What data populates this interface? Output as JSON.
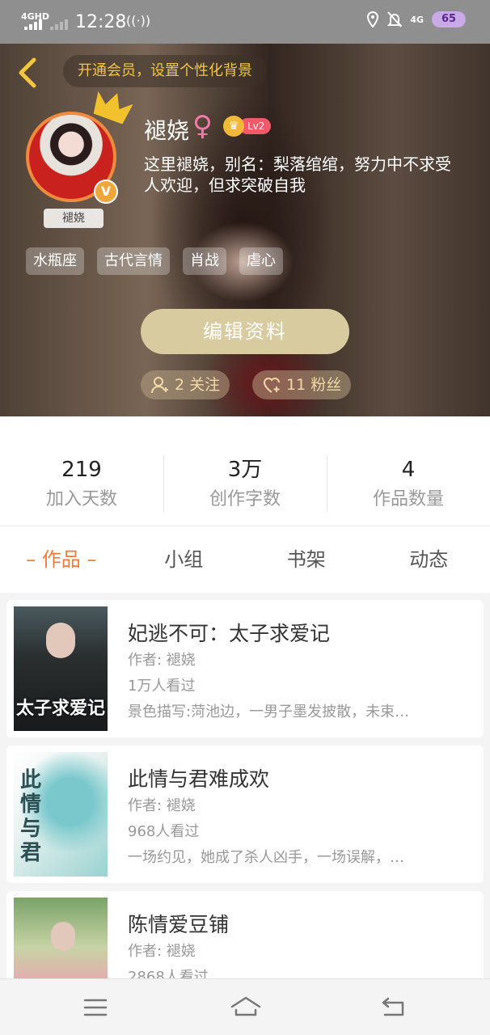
{
  "status_bar": {
    "network_left": "4GHD",
    "time": "12:28",
    "network_right": "4G",
    "battery": "65"
  },
  "hero": {
    "vip_banner": "开通会员，设置个性化背景",
    "avatar_name": "褪娆",
    "username": "褪娆",
    "gender_symbol": "♀",
    "level": "Lv2",
    "verified_mark": "V",
    "bio": "这里褪娆，别名：梨落绾绾，努力中不求受人欢迎，但求突破自我",
    "tags": [
      "水瓶座",
      "古代言情",
      "肖战",
      "虐心"
    ],
    "edit_button": "编辑资料",
    "following": "2 关注",
    "followers": "11 粉丝"
  },
  "stats": [
    {
      "value": "219",
      "label": "加入天数"
    },
    {
      "value": "3万",
      "label": "创作字数"
    },
    {
      "value": "4",
      "label": "作品数量"
    }
  ],
  "tabs": [
    {
      "label": "– 作品 –",
      "active": true
    },
    {
      "label": "小组",
      "active": false
    },
    {
      "label": "书架",
      "active": false
    },
    {
      "label": "动态",
      "active": false
    }
  ],
  "works": [
    {
      "title": "妃逃不可：太子求爱记",
      "author": "作者: 褪娆",
      "views": "1万人看过",
      "desc": "景色描写:菏池边，一男子墨发披散，未束…",
      "cover_text": "太子求爱记"
    },
    {
      "title": "此情与君难成欢",
      "author": "作者: 褪娆",
      "views": "968人看过",
      "desc": "一场约见，她成了杀人凶手，一场误解，…",
      "cover_text": "此情与君"
    },
    {
      "title": "陈情爱豆铺",
      "author": "作者: 褪娆",
      "views": "2868人看过",
      "desc": "",
      "cover_text": ""
    }
  ],
  "colors": {
    "accent": "#f07a3a",
    "vip_gold": "#f3c544",
    "edit_button_bg": "#d8cba0",
    "status_bar": "#8f8f8f"
  }
}
